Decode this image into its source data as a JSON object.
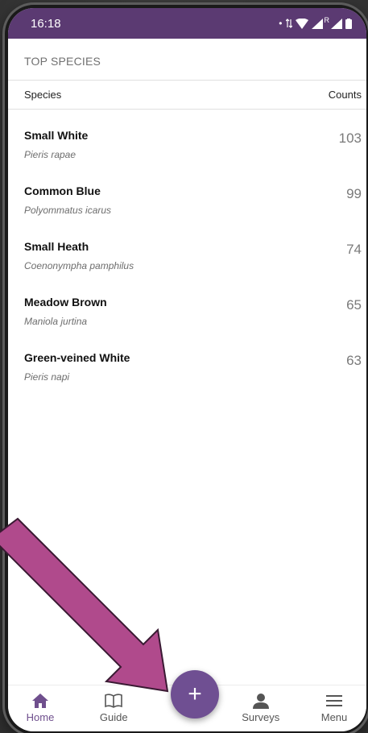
{
  "status_bar": {
    "time": "16:18",
    "dot": "•",
    "roaming": "R"
  },
  "header": {
    "section_title": "TOP SPECIES"
  },
  "table": {
    "col_species": "Species",
    "col_counts": "Counts",
    "rows": [
      {
        "common": "Small White",
        "scientific": "Pieris rapae",
        "count": "103"
      },
      {
        "common": "Common Blue",
        "scientific": "Polyommatus icarus",
        "count": "99"
      },
      {
        "common": "Small Heath",
        "scientific": "Coenonympha pamphilus",
        "count": "74"
      },
      {
        "common": "Meadow Brown",
        "scientific": "Maniola jurtina",
        "count": "65"
      },
      {
        "common": "Green-veined White",
        "scientific": "Pieris napi",
        "count": "63"
      }
    ]
  },
  "tabbar": {
    "home": "Home",
    "guide": "Guide",
    "add": "+",
    "surveys": "Surveys",
    "menu": "Menu"
  },
  "colors": {
    "status_bar": "#5b3a72",
    "accent": "#6f4f92",
    "arrow": "#b04a8c"
  },
  "icons": {
    "home": "home-icon",
    "guide": "book-icon",
    "add": "plus-icon",
    "surveys": "person-icon",
    "menu": "hamburger-icon"
  }
}
